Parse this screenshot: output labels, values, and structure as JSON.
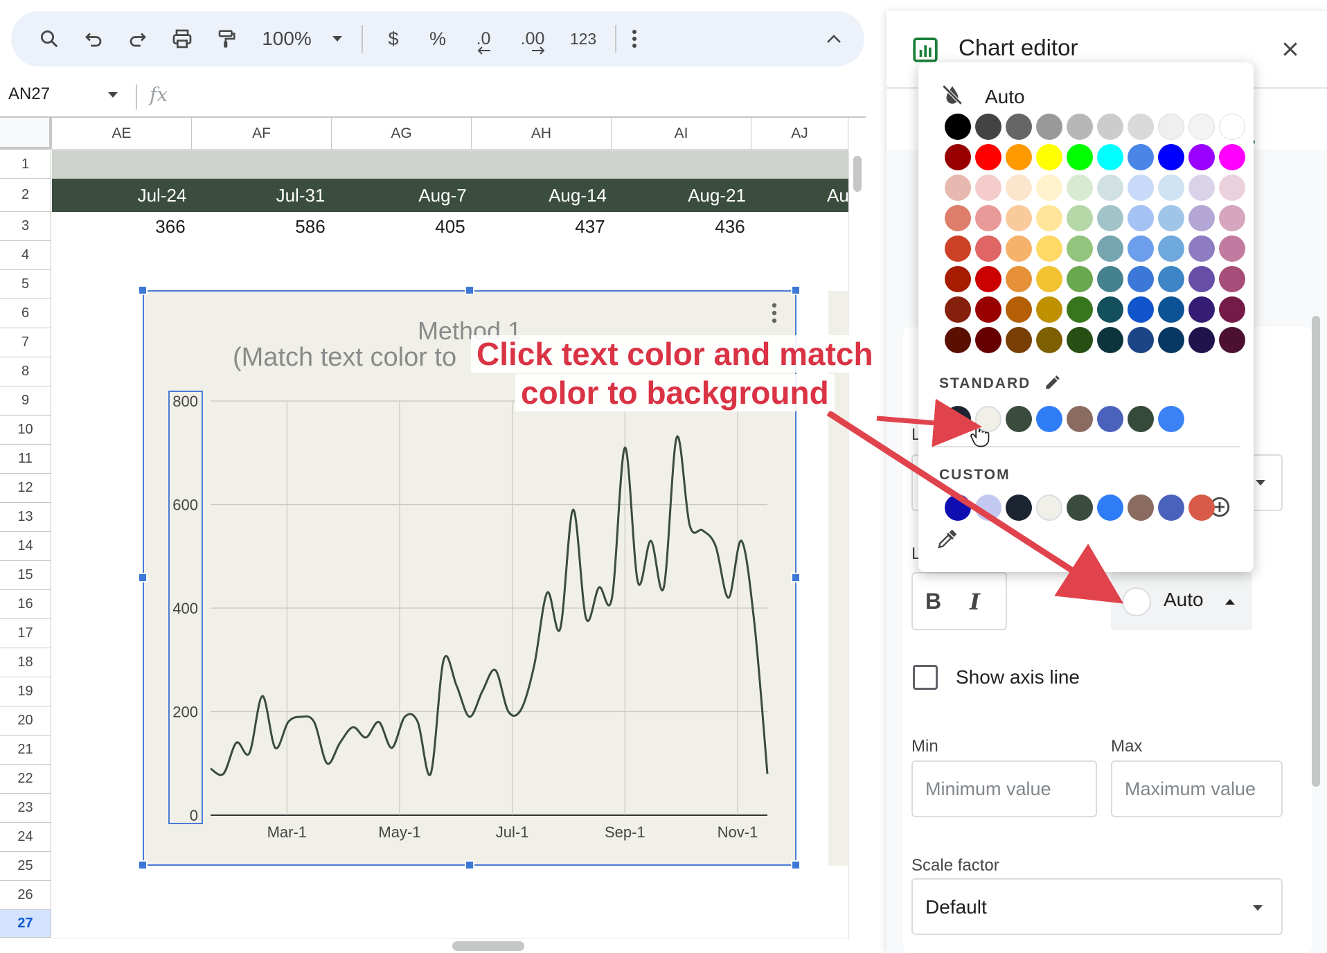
{
  "toolbar": {
    "zoom": "100%",
    "currency": "$",
    "percent": "%",
    "decrease_decimals": ".0",
    "increase_decimals": ".00",
    "number_format": "123"
  },
  "formula_bar": {
    "cell_ref": "AN27",
    "fx_label": "fx"
  },
  "columns": [
    "AE",
    "AF",
    "AG",
    "AH",
    "AI",
    "AJ"
  ],
  "rows": [
    "1",
    "2",
    "3",
    "4",
    "5",
    "6",
    "7",
    "8",
    "9",
    "10",
    "11",
    "12",
    "13",
    "14",
    "15",
    "16",
    "17",
    "18",
    "19",
    "20",
    "21",
    "22",
    "23",
    "24",
    "25",
    "26",
    "27"
  ],
  "active_row": "27",
  "sheet": {
    "header_dates": [
      "Jul-24",
      "Jul-31",
      "Aug-7",
      "Aug-14",
      "Aug-21",
      "Au"
    ],
    "values": [
      "366",
      "586",
      "405",
      "437",
      "436"
    ]
  },
  "chart_data": {
    "type": "line",
    "title": "Method 1",
    "subtitle": "(Match text color to",
    "x_tick_labels": [
      "Mar-1",
      "May-1",
      "Jul-1",
      "Sep-1",
      "Nov-1"
    ],
    "y_tick_labels": [
      "0",
      "200",
      "400",
      "600",
      "800"
    ],
    "ylim": [
      0,
      800
    ],
    "x_range": [
      "Jan-24",
      "Nov-21"
    ],
    "grid": true,
    "series": [
      {
        "color": "#3a4c3e",
        "x": [
          0,
          1,
          2,
          3,
          4,
          5,
          6,
          7,
          8,
          9,
          10,
          11,
          12,
          13,
          14,
          15,
          16,
          17,
          18,
          19,
          20,
          21,
          22,
          23,
          24,
          25,
          26,
          27,
          28,
          29,
          30,
          31,
          32,
          33,
          34,
          35,
          36,
          37,
          38,
          39,
          40,
          41,
          42,
          43
        ],
        "values": [
          90,
          80,
          140,
          120,
          230,
          130,
          180,
          190,
          180,
          100,
          140,
          170,
          150,
          180,
          130,
          190,
          180,
          80,
          300,
          250,
          190,
          240,
          280,
          200,
          205,
          290,
          430,
          360,
          590,
          380,
          440,
          420,
          710,
          450,
          530,
          440,
          730,
          560,
          550,
          520,
          420,
          530,
          370,
          80
        ]
      }
    ]
  },
  "panel": {
    "title": "Chart editor",
    "bold_label": "B",
    "italic_label": "I",
    "text_color_value": "Auto",
    "show_axis_line_label": "Show axis line",
    "min_label": "Min",
    "max_label": "Max",
    "min_placeholder": "Minimum value",
    "max_placeholder": "Maximum value",
    "scale_factor_label": "Scale factor",
    "scale_factor_value": "Default",
    "hidden_partial_label_1": "L",
    "hidden_partial_label_2": "L"
  },
  "color_popup": {
    "auto_label": "Auto",
    "standard_label": "STANDARD",
    "custom_label": "CUSTOM",
    "grid_colors": [
      [
        "#000000",
        "#434343",
        "#666666",
        "#999999",
        "#b7b7b7",
        "#cccccc",
        "#d9d9d9",
        "#efefef",
        "#f3f3f3",
        "#ffffff"
      ],
      [
        "#980000",
        "#ff0000",
        "#ff9900",
        "#ffff00",
        "#00ff00",
        "#00ffff",
        "#4a86e8",
        "#0000ff",
        "#9900ff",
        "#ff00ff"
      ],
      [
        "#e6b8af",
        "#f4cccc",
        "#fce5cd",
        "#fff2cc",
        "#d9ead3",
        "#d0e0e3",
        "#c9daf8",
        "#cfe2f3",
        "#d9d2e9",
        "#ead1dc"
      ],
      [
        "#dd7e6b",
        "#ea9999",
        "#f9cb9c",
        "#ffe599",
        "#b6d7a8",
        "#a2c4c9",
        "#a4c2f4",
        "#9fc5e8",
        "#b4a7d6",
        "#d5a6bd"
      ],
      [
        "#cc4125",
        "#e06666",
        "#f6b26b",
        "#ffd966",
        "#93c47d",
        "#76a5af",
        "#6d9eeb",
        "#6fa8dc",
        "#8e7cc3",
        "#c27ba0"
      ],
      [
        "#a61c00",
        "#cc0000",
        "#e69138",
        "#f1c232",
        "#6aa84f",
        "#45818e",
        "#3c78d8",
        "#3d85c6",
        "#674ea7",
        "#a64d79"
      ],
      [
        "#85200c",
        "#990000",
        "#b45f06",
        "#bf9000",
        "#38761d",
        "#134f5c",
        "#1155cc",
        "#0b5394",
        "#351c75",
        "#741b47"
      ],
      [
        "#5b0f00",
        "#660000",
        "#783f04",
        "#7f6000",
        "#274e13",
        "#0c343d",
        "#1c4587",
        "#073763",
        "#20124d",
        "#4c1130"
      ]
    ],
    "standard_colors": [
      "#1b2430",
      "#f1f0e8",
      "#3a4c3e",
      "#2e7cf6",
      "#8a6b60",
      "#4b62bd",
      "#364a3b",
      "#3b82f6"
    ],
    "custom_colors": [
      "#0d0db1",
      "#c3c8f0",
      "#1b2430",
      "#f1f0e8",
      "#3a4c3e",
      "#2e7cf6",
      "#8a6b60",
      "#4b62bd",
      "#d75b48"
    ]
  },
  "annotation": {
    "line1": "Click text color and match",
    "line2": "color to background",
    "color": "#d93344"
  }
}
